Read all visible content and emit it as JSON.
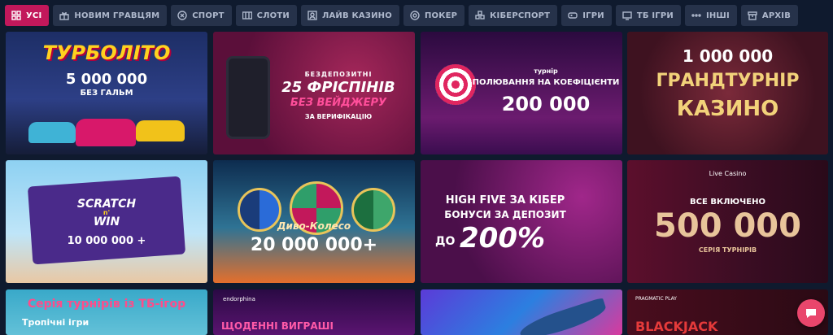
{
  "tabs": [
    {
      "label": "УСІ",
      "icon": "grid-icon",
      "active": true
    },
    {
      "label": "НОВИМ ГРАВЦЯМ",
      "icon": "gift-icon"
    },
    {
      "label": "СПОРТ",
      "icon": "ball-icon"
    },
    {
      "label": "СЛОТИ",
      "icon": "slots-icon"
    },
    {
      "label": "ЛАЙВ КАЗИНО",
      "icon": "dealer-icon"
    },
    {
      "label": "ПОКЕР",
      "icon": "poker-chip-icon"
    },
    {
      "label": "КІБЕРСПОРТ",
      "icon": "esports-icon"
    },
    {
      "label": "ІГРИ",
      "icon": "gamepad-icon"
    },
    {
      "label": "ТБ ІГРИ",
      "icon": "tv-icon"
    },
    {
      "label": "ІНШІ",
      "icon": "dots-icon"
    },
    {
      "label": "АРХІВ",
      "icon": "archive-icon"
    }
  ],
  "cards": [
    {
      "id": "turbolito",
      "lines": [
        "ТУРБОЛІТО",
        "5 000 000",
        "БЕЗ ГАЛЬМ"
      ],
      "bg": "#1b2a5c"
    },
    {
      "id": "freespins",
      "lines": [
        "БЕЗДЕПОЗИТНІ",
        "25 ФРІСПІНІВ",
        "БЕЗ ВЕЙДЖЕРУ",
        "ЗА ВЕРИФІКАЦІЮ"
      ],
      "bg": "#5a0f3a"
    },
    {
      "id": "odds-hunt",
      "lines": [
        "турнір",
        "ПОЛЮВАННЯ НА КОЕФІЦІЄНТИ",
        "200 000"
      ],
      "bg": "#3a0d4f"
    },
    {
      "id": "grand-casino",
      "lines": [
        "1 000 000",
        "ГРАНДТУРНІР",
        "КАЗИНО"
      ],
      "bg": "#5a1d2a"
    },
    {
      "id": "scratch",
      "lines": [
        "SCRATCH",
        "n'",
        "WIN",
        "10 000 000 +"
      ],
      "bg": "#7fc4e8"
    },
    {
      "id": "wheel",
      "lines": [
        "Диво-Колесо",
        "20 000 000+"
      ],
      "bg": "#123a55"
    },
    {
      "id": "highfive",
      "lines": [
        "HIGH FIVE ЗА КІБЕР",
        "БОНУСИ ЗА ДЕПОЗИТ",
        "ДО",
        "200%"
      ],
      "bg": "#4b0f4a"
    },
    {
      "id": "live-casino",
      "lines": [
        "Live Casino",
        "ВСЕ ВКЛЮЧЕНО",
        "500 000",
        "СЕРІЯ ТУРНІРІВ"
      ],
      "bg": "#3a0d23"
    },
    {
      "id": "tv-games",
      "lines": [
        "Серія турнірів із ТБ-ігор",
        "Тропічні ігри"
      ],
      "bg": "#3aa8c8"
    },
    {
      "id": "endorphina",
      "lines": [
        "endorphina",
        "ЩОДЕННІ ВИГРАШІ"
      ],
      "bg": "#3b0d57"
    },
    {
      "id": "fish",
      "lines": [],
      "bg": "#3b3fd8"
    },
    {
      "id": "blackjack",
      "lines": [
        "PRAGMATIC PLAY",
        "BLACKJACK"
      ],
      "bg": "#4a0d1e"
    }
  ]
}
